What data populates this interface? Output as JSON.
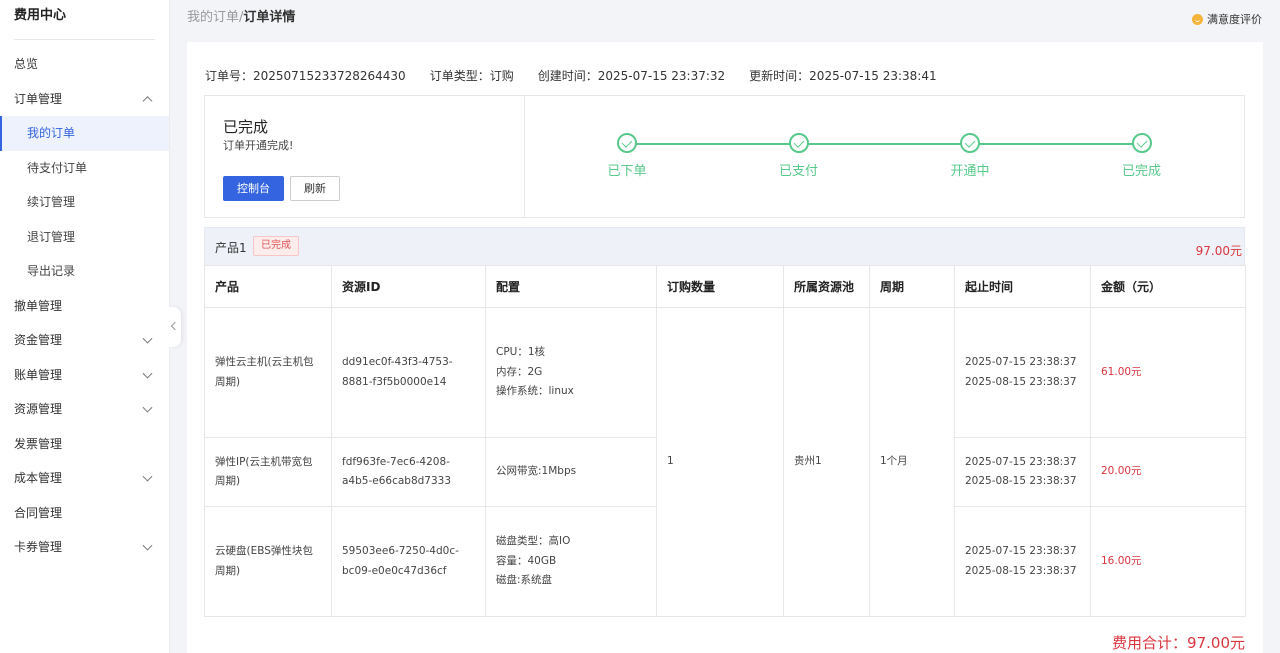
{
  "sidebar": {
    "title": "费用中心",
    "items": [
      {
        "label": "总览",
        "level": 0,
        "chevron": ""
      },
      {
        "label": "订单管理",
        "level": 0,
        "chevron": "up"
      },
      {
        "label": "我的订单",
        "level": 1,
        "chevron": "",
        "active": true
      },
      {
        "label": "待支付订单",
        "level": 1,
        "chevron": ""
      },
      {
        "label": "续订管理",
        "level": 1,
        "chevron": ""
      },
      {
        "label": "退订管理",
        "level": 1,
        "chevron": ""
      },
      {
        "label": "导出记录",
        "level": 1,
        "chevron": ""
      },
      {
        "label": "撤单管理",
        "level": 0,
        "chevron": ""
      },
      {
        "label": "资金管理",
        "level": 0,
        "chevron": "down"
      },
      {
        "label": "账单管理",
        "level": 0,
        "chevron": "down"
      },
      {
        "label": "资源管理",
        "level": 0,
        "chevron": "down"
      },
      {
        "label": "发票管理",
        "level": 0,
        "chevron": ""
      },
      {
        "label": "成本管理",
        "level": 0,
        "chevron": "down"
      },
      {
        "label": "合同管理",
        "level": 0,
        "chevron": ""
      },
      {
        "label": "卡券管理",
        "level": 0,
        "chevron": "down"
      }
    ]
  },
  "header": {
    "breadcrumb_parent": "我的订单",
    "breadcrumb_sep": "/",
    "breadcrumb_current": "订单详情",
    "rating_label": "满意度评价",
    "rating_icon": "smile-icon"
  },
  "order": {
    "number": "订单号：20250715233728264430",
    "type": "订单类型：订购",
    "created": "创建时间：2025-07-15 23:37:32",
    "updated": "更新时间：2025-07-15 23:38:41"
  },
  "status": {
    "title": "已完成",
    "desc": "订单开通完成!",
    "console_button": "控制台",
    "refresh_button": "刷新",
    "steps": [
      "已下单",
      "已支付",
      "开通中",
      "已完成"
    ],
    "color": "#58c98a"
  },
  "product": {
    "name": "产品1",
    "badge": "已完成",
    "amount": "97.00元"
  },
  "table": {
    "headers": [
      "产品",
      "资源ID",
      "配置",
      "订购数量",
      "所属资源池",
      "周期",
      "起止时间",
      "金额（元）"
    ],
    "rows": [
      {
        "product": "弹性云主机(云主机包周期)",
        "resource_id": "dd91ec0f-43f3-4753-8881-f3f5b0000e14",
        "config": [
          "CPU：1核",
          "内存：2G",
          "操作系统：linux"
        ],
        "start": "2025-07-15 23:38:37",
        "end": "2025-08-15 23:38:37",
        "amount": "61.00元"
      },
      {
        "product": "弹性IP(云主机带宽包周期)",
        "resource_id": "fdf963fe-7ec6-4208-a4b5-e66cab8d7333",
        "config": [
          "公网带宽:1Mbps"
        ],
        "start": "2025-07-15 23:38:37",
        "end": "2025-08-15 23:38:37",
        "amount": "20.00元"
      },
      {
        "product": "云硬盘(EBS弹性块包周期)",
        "resource_id": "59503ee6-7250-4d0c-bc09-e0e0c47d36cf",
        "config": [
          "磁盘类型：高IO",
          "容量：40GB",
          "磁盘:系统盘"
        ],
        "start": "2025-07-15 23:38:37",
        "end": "2025-08-15 23:38:37",
        "amount": "16.00元"
      }
    ],
    "quantity": "1",
    "pool": "贵州1",
    "period": "1个月"
  },
  "total": "费用合计：97.00元",
  "colors": {
    "accent": "#3564e0",
    "success": "#58c98a",
    "danger": "#d9363e"
  }
}
